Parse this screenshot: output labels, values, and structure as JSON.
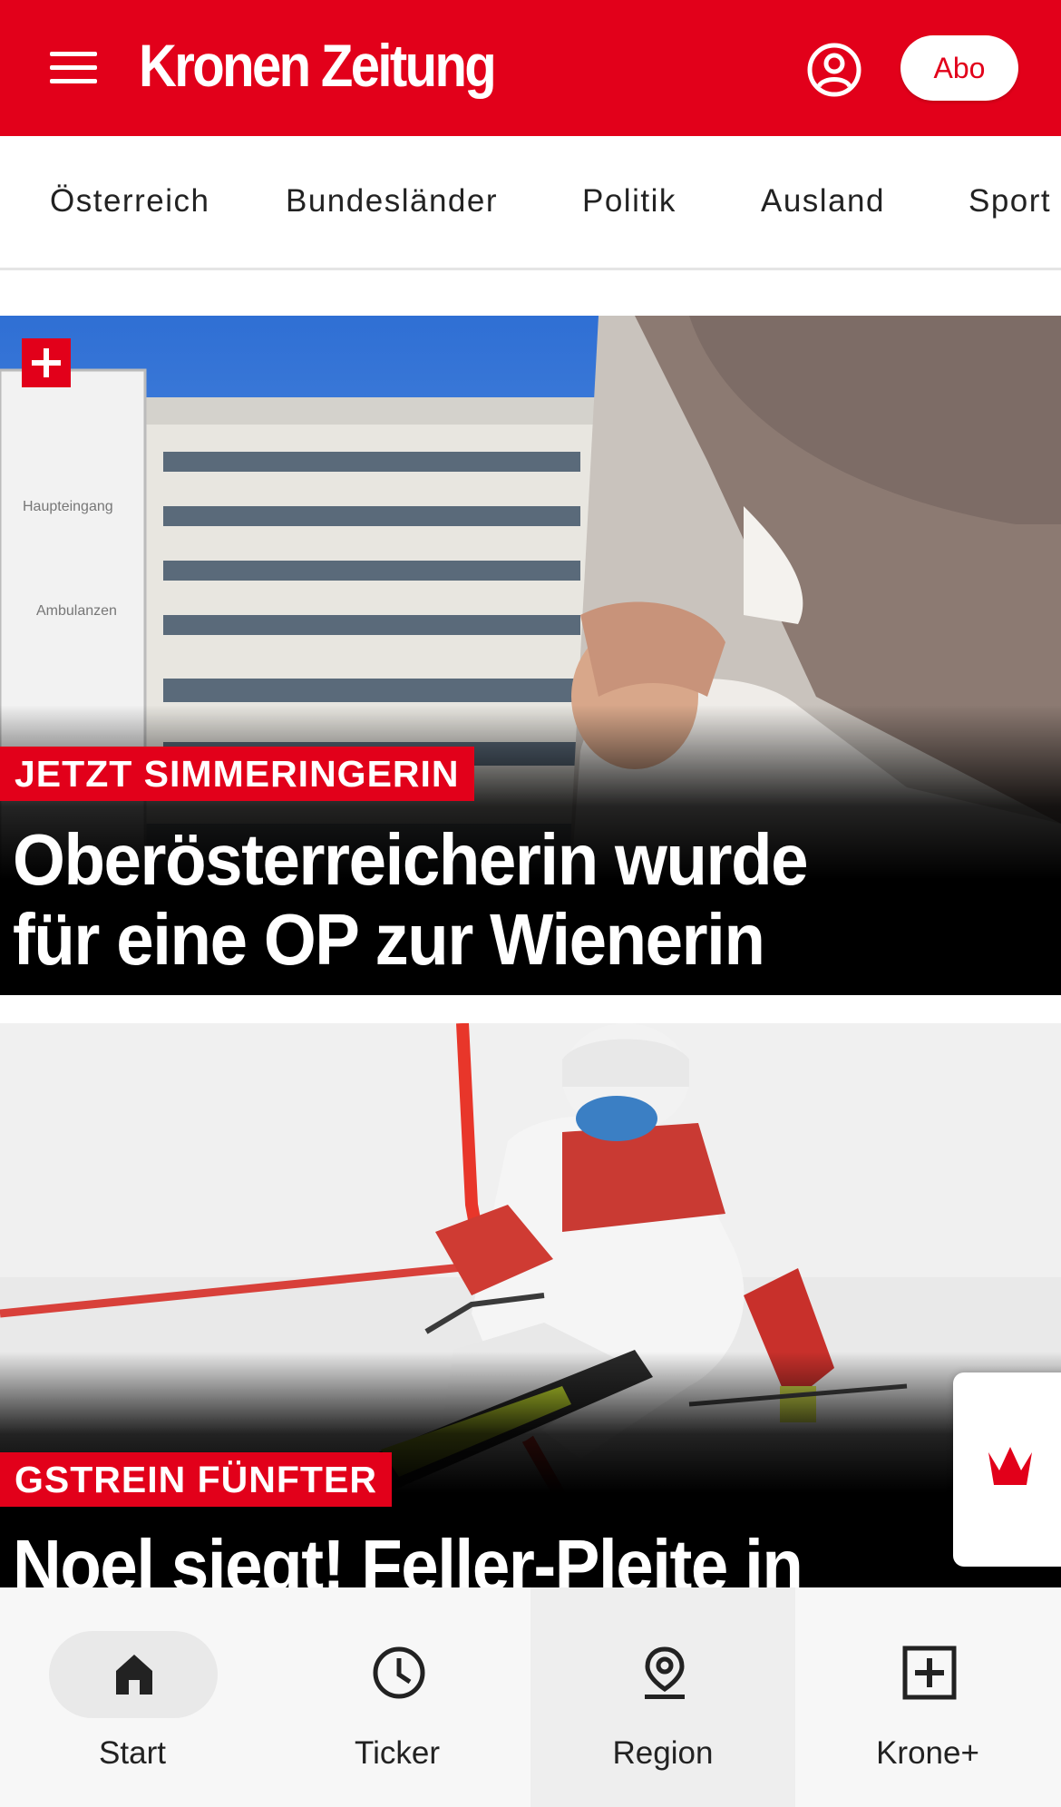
{
  "header": {
    "logo": "Kronen Zeitung",
    "abo_label": "Abo",
    "brand_color": "#e2001a",
    "menu_icon": "hamburger-menu-icon",
    "account_icon": "user-account-icon"
  },
  "categories": [
    "Österreich",
    "Bundesländer",
    "Politik",
    "Ausland",
    "Sport"
  ],
  "articles": [
    {
      "kicker": "JETZT SIMMERINGERIN",
      "headline": "Oberösterreicherin wurde für eine OP zur Wienerin",
      "badge_icon": "plus-icon"
    },
    {
      "kicker": "GSTREIN FÜNFTER",
      "headline": "Noel siegt! Feller-Pleite in"
    }
  ],
  "floating_tab": {
    "icon": "crown-icon"
  },
  "bottom_nav": [
    {
      "label": "Start",
      "icon": "home-icon",
      "active": true
    },
    {
      "label": "Ticker",
      "icon": "clock-icon"
    },
    {
      "label": "Region",
      "icon": "location-pin-icon"
    },
    {
      "label": "Krone+",
      "icon": "plus-box-icon"
    }
  ]
}
